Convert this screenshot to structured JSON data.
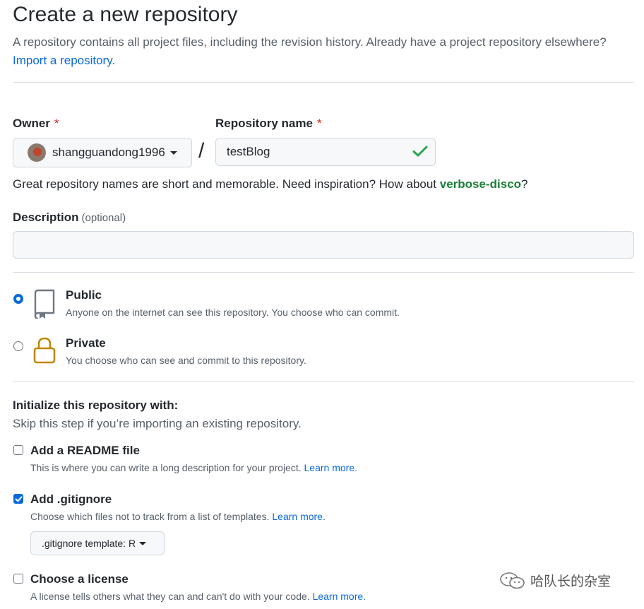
{
  "header": {
    "title": "Create a new repository",
    "intro_text": "A repository contains all project files, including the revision history. Already have a project repository elsewhere?",
    "import_link": "Import a repository."
  },
  "owner": {
    "label": "Owner",
    "required_mark": "*",
    "value": "shangguandong1996"
  },
  "separator": "/",
  "repo_name": {
    "label": "Repository name",
    "required_mark": "*",
    "value": "testBlog"
  },
  "name_hint": {
    "prefix": "Great repository names are short and memorable. Need inspiration? How about ",
    "suggestion": "verbose-disco",
    "suffix": "?"
  },
  "description": {
    "label": "Description",
    "optional": "(optional)",
    "value": ""
  },
  "visibility": {
    "selected": "public",
    "options": [
      {
        "title": "Public",
        "subtitle": "Anyone on the internet can see this repository. You choose who can commit."
      },
      {
        "title": "Private",
        "subtitle": "You choose who can see and commit to this repository."
      }
    ]
  },
  "initialize": {
    "title": "Initialize this repository with:",
    "subtitle": "Skip this step if you’re importing an existing repository.",
    "readme": {
      "label": "Add a README file",
      "desc": "This is where you can write a long description for your project.",
      "link": "Learn more.",
      "checked": false
    },
    "gitignore": {
      "label": "Add .gitignore",
      "desc": "Choose which files not to track from a list of templates.",
      "link": "Learn more.",
      "checked": true,
      "template_label": ".gitignore template: R"
    },
    "license": {
      "label": "Choose a license",
      "desc": "A license tells others what they can and can't do with your code.",
      "link": "Learn more.",
      "checked": false
    }
  },
  "watermark": "哈队长的杂室",
  "colors": {
    "link": "#0969da",
    "success": "#1a7f37",
    "required": "#cf222e",
    "lock": "#bf8700"
  }
}
